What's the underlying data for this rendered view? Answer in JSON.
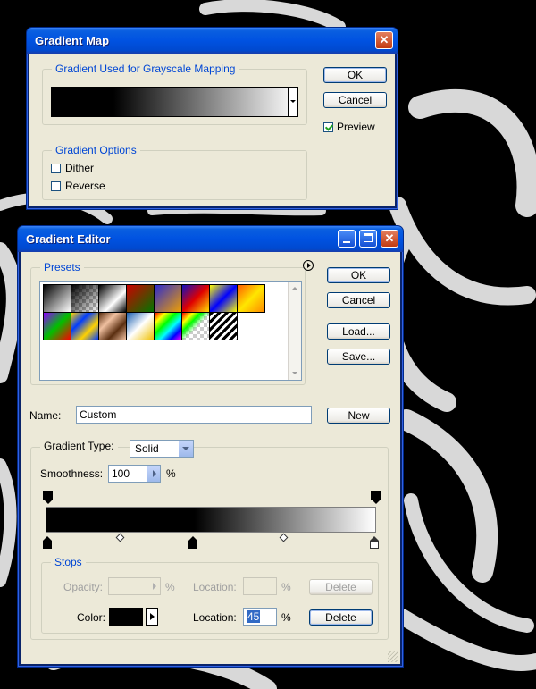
{
  "gradient_map": {
    "title": "Gradient Map",
    "group_mapping_label": "Gradient Used for Grayscale Mapping",
    "group_options_label": "Gradient Options",
    "ok_label": "OK",
    "cancel_label": "Cancel",
    "preview_label": "Preview",
    "preview_checked": true,
    "dither_label": "Dither",
    "dither_checked": false,
    "reverse_label": "Reverse",
    "reverse_checked": false,
    "close_icon": "close-icon"
  },
  "gradient_editor": {
    "title": "Gradient Editor",
    "presets_label": "Presets",
    "ok_label": "OK",
    "cancel_label": "Cancel",
    "load_label": "Load...",
    "save_label": "Save...",
    "name_label": "Name:",
    "name_value": "Custom",
    "new_label": "New",
    "gradient_type_label": "Gradient Type:",
    "gradient_type_value": "Solid",
    "smoothness_label": "Smoothness:",
    "smoothness_value": "100",
    "smoothness_unit": "%",
    "stops_label": "Stops",
    "opacity_label": "Opacity:",
    "opacity_unit": "%",
    "opacity_location_label": "Location:",
    "opacity_location_unit": "%",
    "opacity_delete_label": "Delete",
    "color_label": "Color:",
    "color_value": "#000000",
    "color_location_label": "Location:",
    "color_location_value": "45",
    "color_location_unit": "%",
    "color_delete_label": "Delete"
  },
  "colors": {
    "accent": "#0046d5",
    "title_bar": "#0052e1",
    "dialog_bg": "#ece9d8"
  }
}
